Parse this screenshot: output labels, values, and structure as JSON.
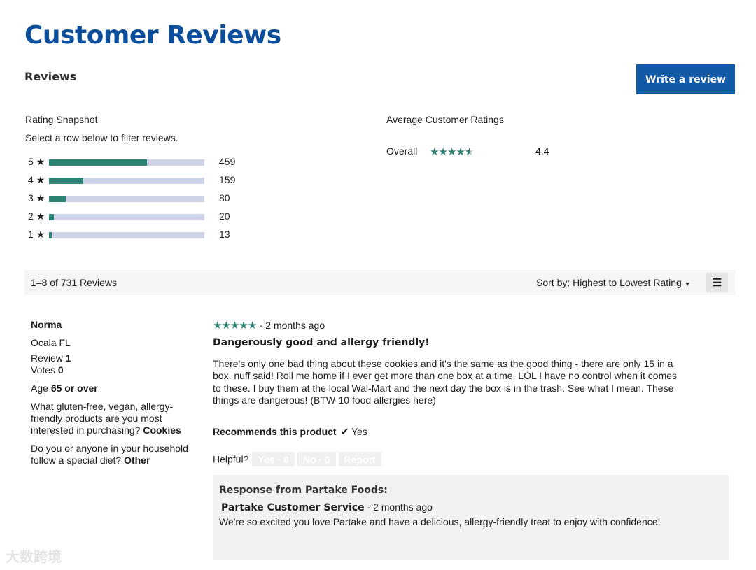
{
  "page": {
    "title": "Customer Reviews"
  },
  "header": {
    "reviews_label": "Reviews",
    "write_review_label": "Write a review"
  },
  "snapshot": {
    "title": "Rating Snapshot",
    "hint": "Select a row below to filter reviews.",
    "rows": [
      {
        "label": "5",
        "count": "459",
        "fraction": 0.63
      },
      {
        "label": "4",
        "count": "159",
        "fraction": 0.22
      },
      {
        "label": "3",
        "count": "80",
        "fraction": 0.11
      },
      {
        "label": "2",
        "count": "20",
        "fraction": 0.03
      },
      {
        "label": "1",
        "count": "13",
        "fraction": 0.02
      }
    ]
  },
  "average": {
    "title": "Average Customer Ratings",
    "overall_label": "Overall",
    "overall_value": "4.4",
    "overall_rating": 4.4
  },
  "toolbar": {
    "count_text": "1–8 of 731 Reviews",
    "sort_prefix": "Sort by: ",
    "sort_value": "Highest to Lowest Rating"
  },
  "reviewer": {
    "name": "Norma",
    "location": "Ocala FL",
    "review_label": "Review",
    "review_count": "1",
    "votes_label": "Votes",
    "votes_count": "0",
    "age_label": "Age",
    "age_value": "65 or over",
    "q1": "What gluten-free, vegan, allergy-friendly products are you most interested in purchasing?",
    "a1": "Cookies",
    "q2": "Do you or anyone in your household follow a special diet?",
    "a2": "Other"
  },
  "review": {
    "rating": 5,
    "time": "· 2 months ago",
    "title": "Dangerously good and allergy friendly!",
    "body": "There's only one bad thing about these cookies and it's the same as the good thing - there are only 15 in a box. nuff said! Roll me home if I ever get more than one box at a time. LOL I have no control when it comes to these. I buy them at the local Wal-Mart and the next day the box is in the trash. See what I mean. These things are dangerous! (BTW-10 food allergies here)",
    "recommends_label": "Recommends this product",
    "recommends_value": "✔ Yes",
    "helpful_label": "Helpful?",
    "yes_btn": "Yes · 0",
    "no_btn": "No · 0",
    "report_btn": "Report"
  },
  "response": {
    "heading": "Response from Partake Foods:",
    "author": "Partake Customer Service",
    "time": "· 2 months ago",
    "text": "We're so excited you love Partake and have a delicious, allergy-friendly treat to enjoy with confidence!"
  },
  "watermark": "大数跨境",
  "colors": {
    "brand_blue": "#0b4f9c",
    "button_blue": "#1259a8",
    "star_green": "#2d8372",
    "bar_track": "#cfd3e8"
  },
  "icons": {
    "star": "star-icon",
    "menu": "menu-icon",
    "caret": "caret-down-icon",
    "check": "check-icon"
  }
}
